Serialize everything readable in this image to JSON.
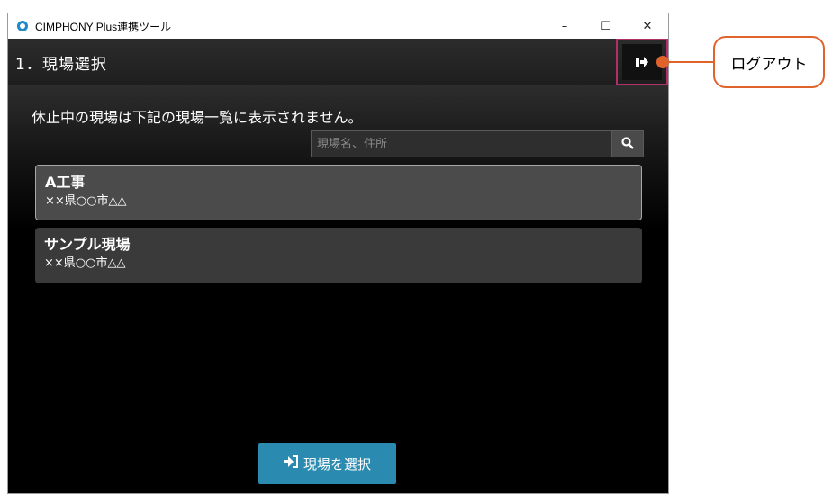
{
  "window": {
    "title": "CIMPHONY Plus連携ツール",
    "controls": {
      "minimize": "–",
      "maximize": "☐",
      "close": "✕"
    }
  },
  "header": {
    "title": "1．現場選択",
    "logout_icon": "logout-icon"
  },
  "main": {
    "notice": "休止中の現場は下記の現場一覧に表示されません。",
    "search": {
      "placeholder": "現場名、住所",
      "value": "",
      "icon": "search-icon"
    },
    "sites": [
      {
        "name": "A工事",
        "address": "××県○○市△△",
        "selected": true
      },
      {
        "name": "サンプル現場",
        "address": "××県○○市△△",
        "selected": false
      }
    ],
    "select_button": {
      "label": "現場を選択",
      "icon": "sign-in-icon"
    }
  },
  "callout": {
    "label": "ログアウト"
  },
  "colors": {
    "accent": "#2a8ab0",
    "callout": "#e0632c",
    "highlight": "#b0306a"
  }
}
